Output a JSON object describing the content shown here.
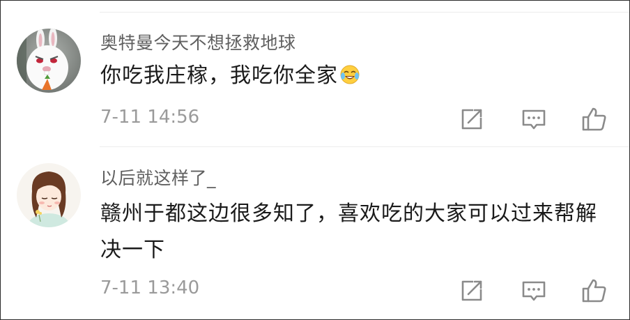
{
  "comments": [
    {
      "username": "奥特曼今天不想拯救地球",
      "text": "你吃我庄稼，我吃你全家",
      "emoji": "laughing-crying-emoji",
      "timestamp": "7-11 14:56",
      "avatar": "white-rabbit-avatar"
    },
    {
      "username": "以后就这样了_",
      "text": "赣州于都这边很多知了，喜欢吃的大家可以过来帮解决一下",
      "timestamp": "7-11 13:40",
      "avatar": "cartoon-girl-avatar"
    }
  ],
  "icons": {
    "share": "share-icon",
    "reply": "comment-icon",
    "like": "thumbs-up-icon"
  },
  "colors": {
    "username": "#5f5f5f",
    "text": "#1a1a1a",
    "timestamp": "#9a9a9a",
    "icon": "#8a8a8a",
    "divider": "#ececec"
  }
}
